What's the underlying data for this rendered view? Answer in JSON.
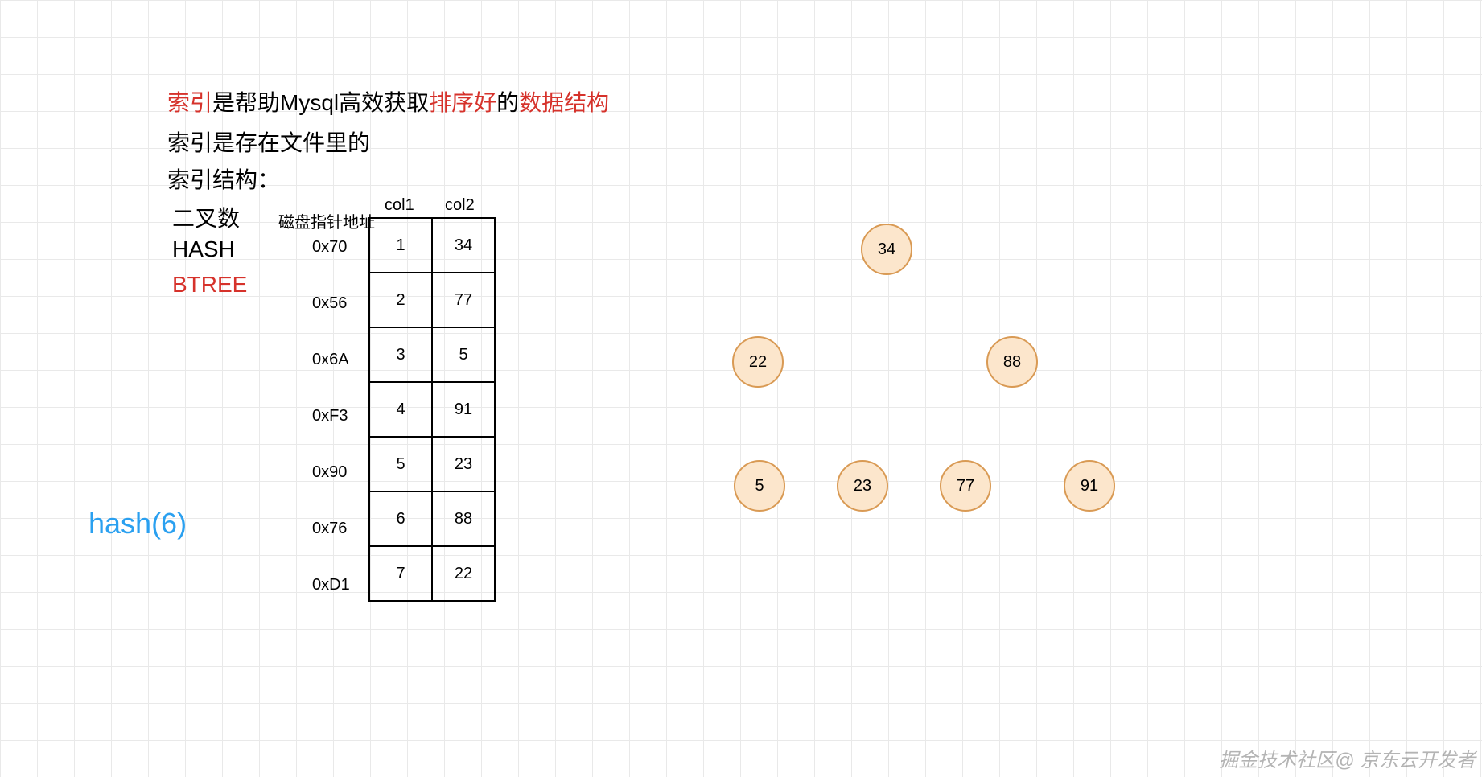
{
  "heading": {
    "red1": "索引",
    "black1": "是帮助Mysql高效获取",
    "red2": "排序好",
    "black2": "的",
    "red3": "数据结构"
  },
  "line2": "索引是存在文件里的",
  "line3": "索引结构：",
  "options": {
    "binary_tree": "二叉数",
    "hash": "HASH",
    "btree": "BTREE"
  },
  "table": {
    "disk_header": "磁盘指针地址",
    "col1_header": "col1",
    "col2_header": "col2",
    "rows": [
      {
        "addr": "0x70",
        "col1": "1",
        "col2": "34"
      },
      {
        "addr": "0x56",
        "col1": "2",
        "col2": "77"
      },
      {
        "addr": "0x6A",
        "col1": "3",
        "col2": "5"
      },
      {
        "addr": "0xF3",
        "col1": "4",
        "col2": "91"
      },
      {
        "addr": "0x90",
        "col1": "5",
        "col2": "23"
      },
      {
        "addr": "0x76",
        "col1": "6",
        "col2": "88"
      },
      {
        "addr": "0xD1",
        "col1": "7",
        "col2": "22"
      }
    ]
  },
  "hash_label": "hash(6)",
  "tree": {
    "root": "34",
    "l": "22",
    "r": "88",
    "ll": "5",
    "lr": "23",
    "rl": "77",
    "rr": "91"
  },
  "watermark": "掘金技术社区@ 京东云开发者"
}
